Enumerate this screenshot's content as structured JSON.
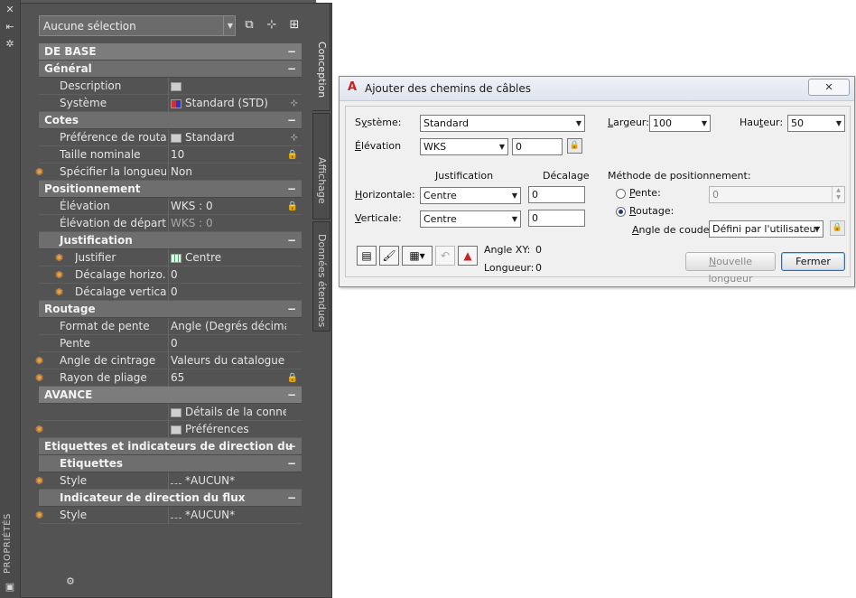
{
  "palette": {
    "strip_title": "PROPRIÉTÉS",
    "selector_value": "Aucune sélection",
    "tabs": [
      "Conception",
      "Affichage",
      "Données étendues"
    ],
    "rows": [
      {
        "type": "cat",
        "level": "main",
        "label": "DE BASE"
      },
      {
        "type": "cat",
        "level": "cat",
        "label": "Général"
      },
      {
        "type": "prop",
        "label": "Description",
        "value": "",
        "icon": "table-icon",
        "star": false
      },
      {
        "type": "prop",
        "label": "Système",
        "value": "Standard (STD)",
        "icon": "system-icon",
        "btn": "pick-icon",
        "star": false
      },
      {
        "type": "cat",
        "level": "cat",
        "label": "Cotes"
      },
      {
        "type": "prop",
        "label": "Préférence de routa...",
        "value": "Standard",
        "icon": "preference-icon",
        "btn": "pick-icon",
        "star": false
      },
      {
        "type": "prop",
        "label": "Taille nominale",
        "value": "10",
        "btn": "lock-icon",
        "star": false
      },
      {
        "type": "prop",
        "label": "Spécifier la longueu...",
        "value": "Non",
        "star": true
      },
      {
        "type": "cat",
        "level": "cat",
        "label": "Positionnement"
      },
      {
        "type": "prop",
        "label": "Élévation",
        "value": "WKS : 0",
        "btn": "lock-icon",
        "star": false
      },
      {
        "type": "prop",
        "label": "Élévation de départ",
        "value": "WKS : 0",
        "dim": true,
        "star": false
      },
      {
        "type": "cat",
        "level": "sub",
        "label": "Justification"
      },
      {
        "type": "prop",
        "deep": true,
        "label": "Justifier",
        "value": "Centre",
        "icon": "justify-icon",
        "star": true
      },
      {
        "type": "prop",
        "deep": true,
        "label": "Décalage horizo...",
        "value": "0",
        "star": true
      },
      {
        "type": "prop",
        "deep": true,
        "label": "Décalage vertical",
        "value": "0",
        "star": true
      },
      {
        "type": "cat",
        "level": "cat",
        "label": "Routage"
      },
      {
        "type": "prop",
        "label": "Format de pente",
        "value": "Angle (Degrés décimaux)",
        "star": false
      },
      {
        "type": "prop",
        "label": "Pente",
        "value": "0",
        "star": false
      },
      {
        "type": "prop",
        "label": "Angle de cintrage",
        "value": "Valeurs du catalogue",
        "star": true
      },
      {
        "type": "prop",
        "label": "Rayon de pliage",
        "value": "65",
        "btn": "lock-icon",
        "star": true
      },
      {
        "type": "cat",
        "level": "main",
        "label": "AVANCE"
      },
      {
        "type": "prop",
        "label": "",
        "value": "Détails de la connexi...",
        "icon": "table-icon",
        "star": false
      },
      {
        "type": "prop",
        "label": "",
        "value": "Préférences",
        "icon": "table-icon",
        "star": true
      },
      {
        "type": "cat",
        "level": "cat",
        "label": "Etiquettes et indicateurs de direction du flux"
      },
      {
        "type": "cat",
        "level": "sub",
        "label": "Etiquettes"
      },
      {
        "type": "prop",
        "label": "Style",
        "value": "*AUCUN*",
        "icon": "style-icon",
        "star": true
      },
      {
        "type": "cat",
        "level": "sub",
        "label": "Indicateur de direction du flux"
      },
      {
        "type": "prop",
        "label": "Style",
        "value": "*AUCUN*",
        "icon": "style-icon",
        "star": true
      }
    ]
  },
  "dialog": {
    "title": "Ajouter des chemins de câbles",
    "close_label": "✕",
    "systeme_label_pre": "S",
    "systeme_label_u": "y",
    "systeme_label_post": "stème:",
    "systeme_value": "Standard",
    "largeur_label_u": "L",
    "largeur_label_post": "argeur:",
    "largeur_value": "100",
    "hauteur_label_pre": "Hau",
    "hauteur_label_u": "t",
    "hauteur_label_post": "eur:",
    "hauteur_value": "50",
    "elevation_label_u": "É",
    "elevation_label_post": "lévation",
    "elevation_mode": "WKS",
    "elevation_value": "0",
    "justification_header": "Justification",
    "decalage_header": "Décalage",
    "horizontale_label_u": "H",
    "horizontale_label_post": "orizontale:",
    "horizontale_value": "Centre",
    "horizontale_offset": "0",
    "verticale_label_u": "V",
    "verticale_label_post": "erticale:",
    "verticale_value": "Centre",
    "verticale_offset": "0",
    "methode_label": "Méthode de positionnement:",
    "pente_label_u": "P",
    "pente_label_post": "ente:",
    "pente_value": "0",
    "routage_label_u": "R",
    "routage_label_post": "outage:",
    "angle_coude_label_u": "A",
    "angle_coude_label_post": "ngle de coude:",
    "angle_coude_value": "Défini par l'utilisateur",
    "angle_xy_label": "Angle XY:",
    "angle_xy_value": "0",
    "longueur_label": "Longueur:",
    "longueur_value": "0",
    "nouvelle_longueur_u": "N",
    "nouvelle_longueur_post": "ouvelle longueur",
    "fermer_label": "Fermer"
  }
}
